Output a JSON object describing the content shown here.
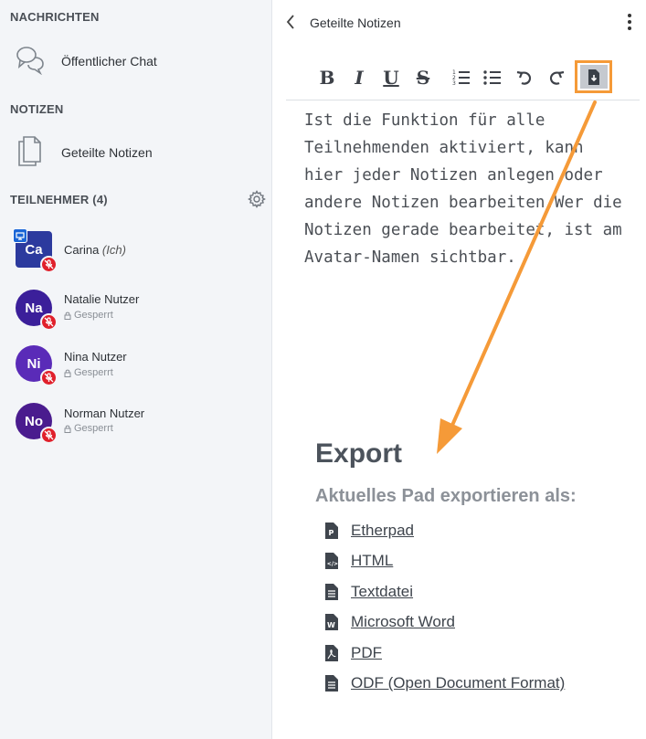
{
  "sidebar": {
    "messages_title": "NACHRICHTEN",
    "public_chat": "Öffentlicher Chat",
    "notes_title": "NOTIZEN",
    "shared_notes": "Geteilte Notizen",
    "participants_title": "TEILNEHMER (4)",
    "users": [
      {
        "initials": "Ca",
        "name": "Carina",
        "suffix": "(Ich)",
        "status": "",
        "color": "#2c3a9e",
        "shape": "square",
        "presenter": true
      },
      {
        "initials": "Na",
        "name": "Natalie Nutzer",
        "suffix": "",
        "status": "Gesperrt",
        "color": "#3b1f9a",
        "shape": "round",
        "presenter": false
      },
      {
        "initials": "Ni",
        "name": "Nina Nutzer",
        "suffix": "",
        "status": "Gesperrt",
        "color": "#5a2bb8",
        "shape": "round",
        "presenter": false
      },
      {
        "initials": "No",
        "name": "Norman Nutzer",
        "suffix": "",
        "status": "Gesperrt",
        "color": "#4a1c8e",
        "shape": "round",
        "presenter": false
      }
    ]
  },
  "panel": {
    "title": "Geteilte Notizen",
    "toolbar": {
      "bold": "B",
      "italic": "I",
      "underline": "U",
      "strike": "S"
    },
    "pad_text": "Ist die Funktion für alle Teilnehmenden aktiviert, kann hier jeder Notizen anlegen oder andere Notizen bearbeiten.Wer die Notizen gerade bearbeitet, ist am Avatar-Namen sichtbar.",
    "export": {
      "title": "Export",
      "subtitle": "Aktuelles Pad exportieren als:",
      "items": [
        {
          "label": "Etherpad",
          "icon": "etherpad-file-icon"
        },
        {
          "label": "HTML",
          "icon": "html-file-icon"
        },
        {
          "label": "Textdatei",
          "icon": "text-file-icon"
        },
        {
          "label": "Microsoft Word",
          "icon": "word-file-icon"
        },
        {
          "label": "PDF",
          "icon": "pdf-file-icon"
        },
        {
          "label": "ODF (Open Document Format)",
          "icon": "odf-file-icon"
        }
      ]
    }
  },
  "colors": {
    "highlight": "#f59a38",
    "mic_badge": "#e0202b",
    "presenter_badge": "#1b66d6"
  }
}
